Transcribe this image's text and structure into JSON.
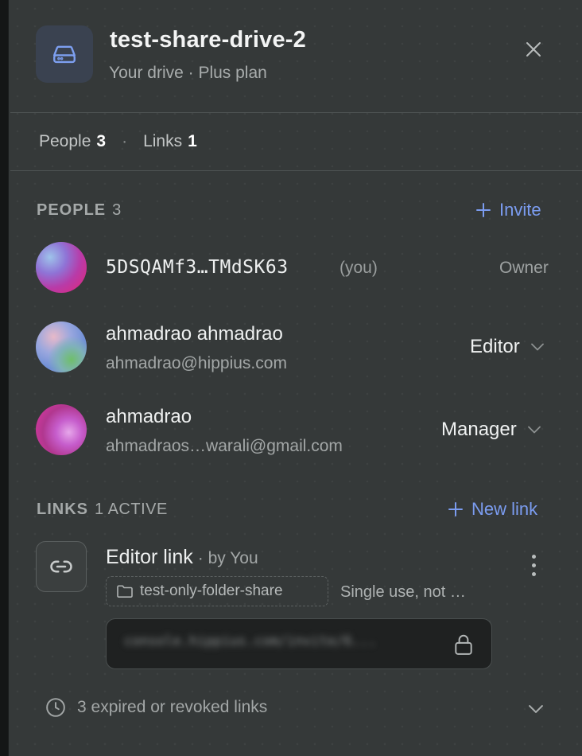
{
  "header": {
    "title": "test-share-drive-2",
    "subtitle": "Your drive · Plus plan",
    "drive_icon": "hard-drive-icon",
    "close_icon": "close-icon"
  },
  "summary": {
    "people_label": "People",
    "people_count": "3",
    "separator": "·",
    "links_label": "Links",
    "links_count": "1"
  },
  "people_section": {
    "title": "PEOPLE",
    "count": "3",
    "action_label": "Invite",
    "members": [
      {
        "name": "5DSQAMf3…TMdSK63",
        "tag": "(you)",
        "role": "Owner"
      },
      {
        "name": "ahmadrao ahmadrao",
        "email": "ahmadrao@hippius.com",
        "role": "Editor"
      },
      {
        "name": "ahmadrao",
        "email": "ahmadraos…warali@gmail.com",
        "role": "Manager"
      }
    ]
  },
  "links_section": {
    "title": "LINKS",
    "count": "1 ACTIVE",
    "action_label": "New link",
    "link": {
      "title": "Editor link",
      "by": "· by You",
      "folder": "test-only-folder-share",
      "description": "Single use, not …",
      "url": "console.hippius.com/invite/6..."
    },
    "expired_label": "3 expired or revoked links"
  },
  "colors": {
    "panel_bg": "#353939",
    "accent": "#7b9cf0",
    "drive_icon_bg": "#3a4250"
  }
}
